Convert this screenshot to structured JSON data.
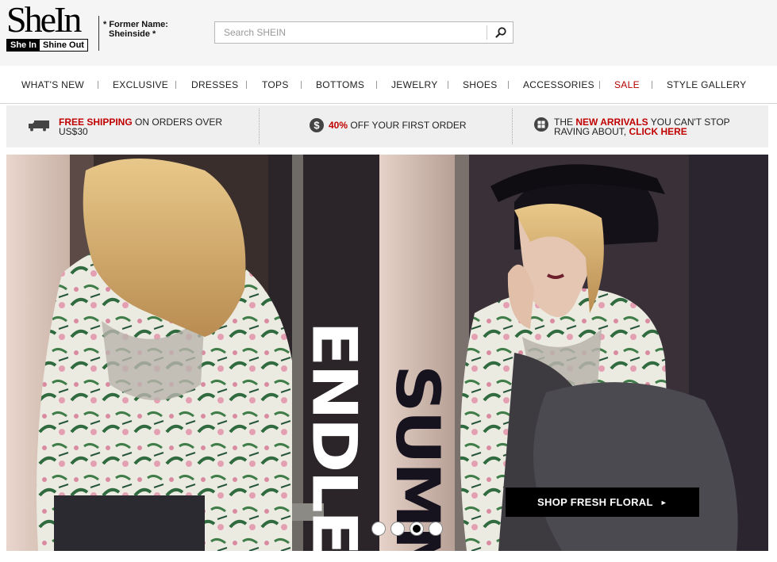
{
  "brand": {
    "logo_text": "SheIn",
    "tagline_left": "She In",
    "tagline_right": "Shine Out",
    "former_label": "* Former Name:",
    "former_value": "Sheinside *"
  },
  "search": {
    "placeholder": "Search SHEIN",
    "value": "",
    "button_icon": "search-icon"
  },
  "nav": {
    "items": [
      {
        "label": "WHAT'S NEW"
      },
      {
        "label": "EXCLUSIVE"
      },
      {
        "label": "DRESSES"
      },
      {
        "label": "TOPS"
      },
      {
        "label": "BOTTOMS"
      },
      {
        "label": "JEWELRY"
      },
      {
        "label": "SHOES"
      },
      {
        "label": "ACCESSORIES"
      },
      {
        "label": "SALE",
        "color": "#b20000"
      },
      {
        "label": "STYLE GALLERY"
      }
    ]
  },
  "promos": [
    {
      "icon": "truck-icon",
      "highlight": "FREE SHIPPING",
      "text": " ON ORDERS OVER US$30"
    },
    {
      "icon": "dollar-icon",
      "highlight": "40%",
      "text": " OFF YOUR FIRST ORDER"
    },
    {
      "icon": "grid-icon",
      "pre": "THE ",
      "highlight": "NEW ARRIVALS",
      "text": " YOU CAN'T STOP RAVING ABOUT, ",
      "link": "CLICK HERE"
    }
  ],
  "hero": {
    "headline_1": "ENDLESS",
    "headline_2": "SUMMER",
    "cta_label": "SHOP FRESH FLORAL",
    "cta_arrow": "►",
    "slides_total": 4,
    "active_slide": 3
  },
  "colors": {
    "accent_red": "#c00000",
    "sale_red": "#b20000",
    "header_bg": "#f5f5f5",
    "promo_bg": "#efefef"
  }
}
